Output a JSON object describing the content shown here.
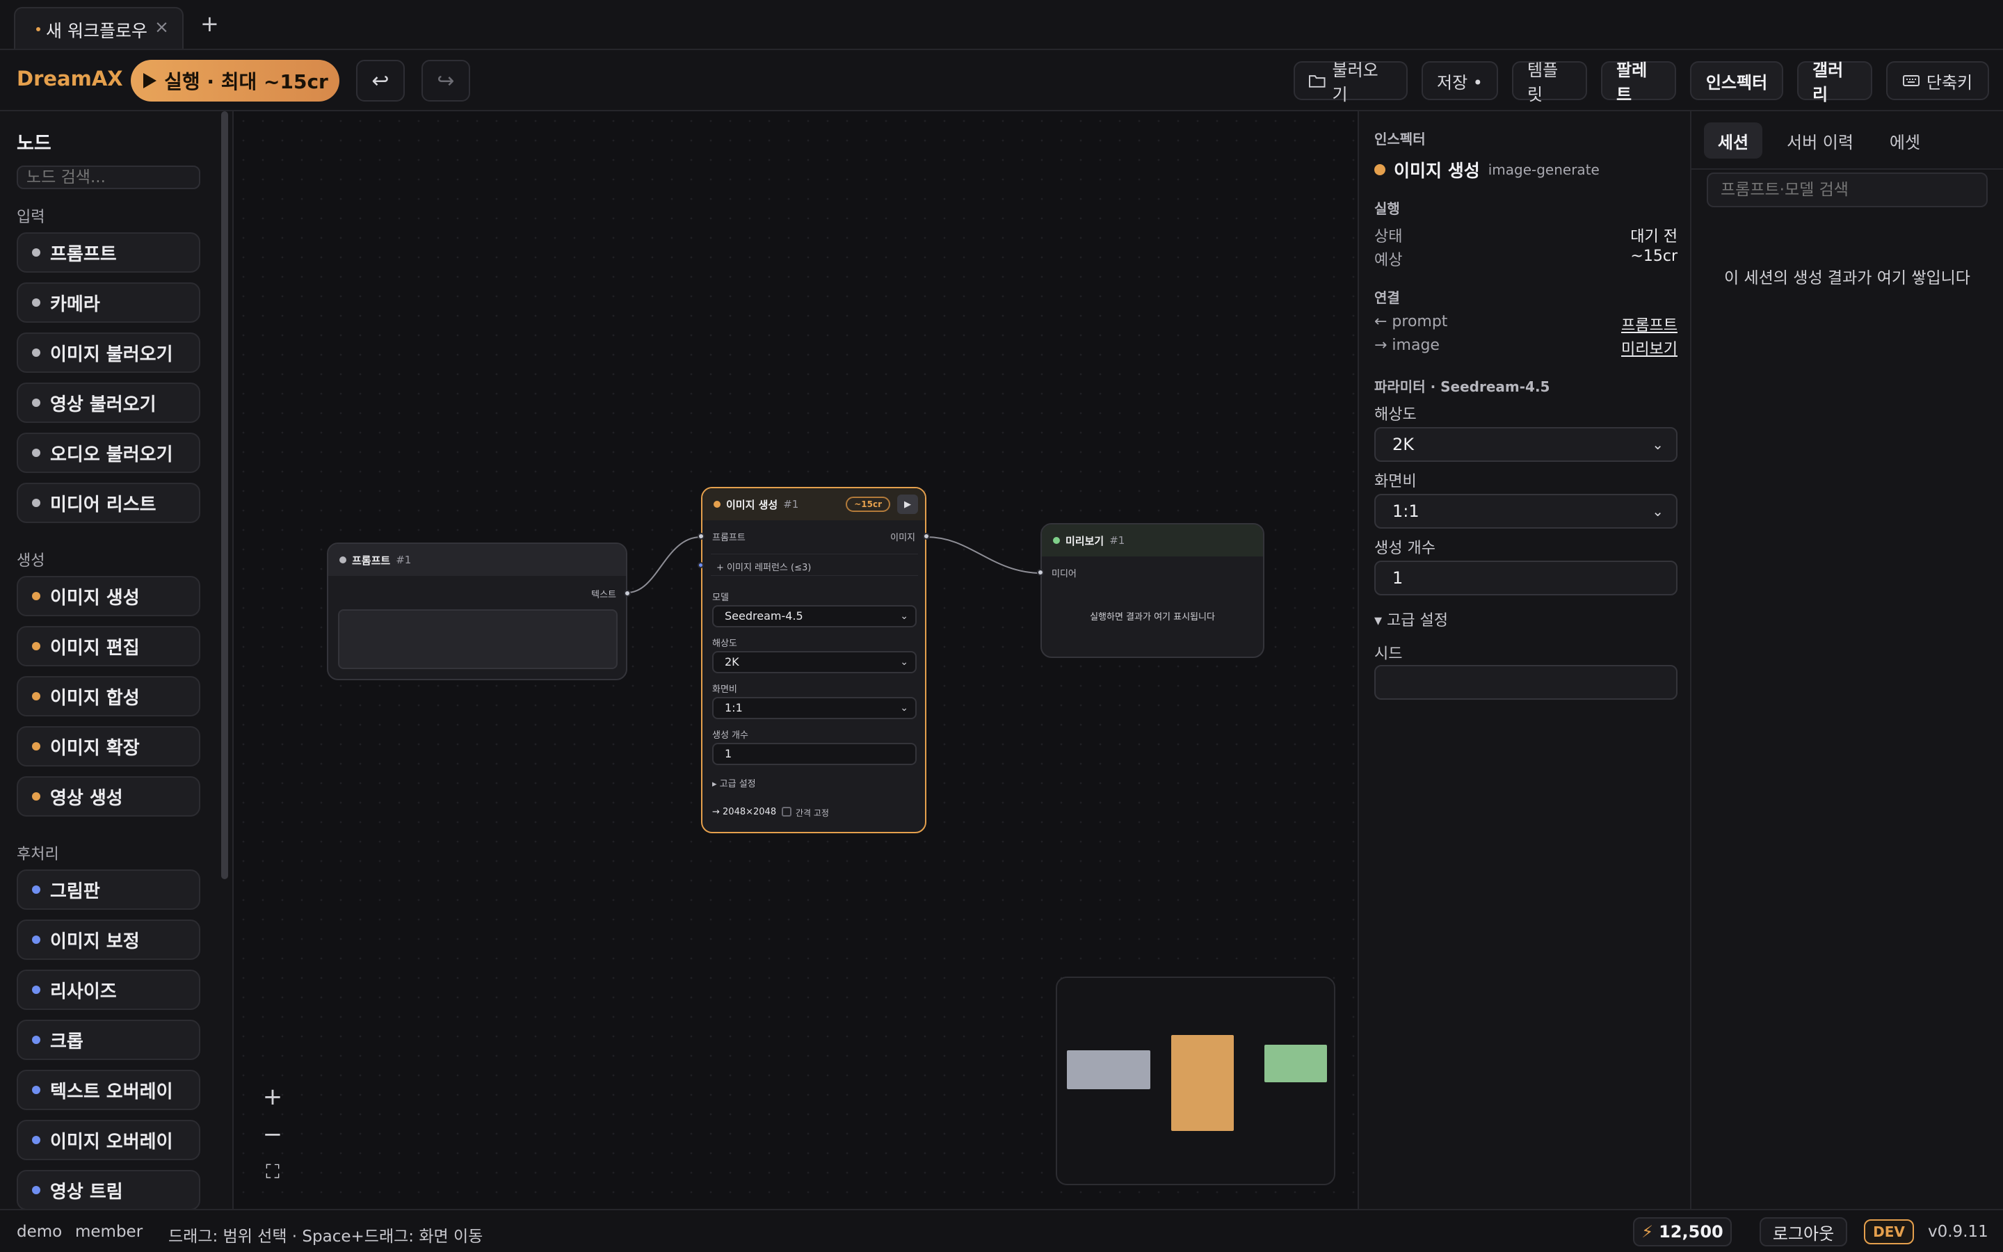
{
  "tab": {
    "title": "새 워크플로우",
    "close": "×",
    "add": "+"
  },
  "toolbar": {
    "logo": "DreamAX",
    "run": "실행 · 최대 ~15cr",
    "undo": "↩",
    "redo": "↪",
    "load": "불러오기",
    "save": "저장 •",
    "template": "템플릿",
    "palette": "팔레트",
    "inspector": "인스펙터",
    "gallery": "갤러리",
    "shortcuts": "단축키"
  },
  "sidebar": {
    "title": "노드",
    "search_placeholder": "노드 검색...",
    "sections": [
      {
        "title": "입력",
        "items": [
          "프롬프트",
          "카메라",
          "이미지 불러오기",
          "영상 불러오기",
          "오디오 불러오기",
          "미디어 리스트"
        ]
      },
      {
        "title": "생성",
        "items": [
          "이미지 생성",
          "이미지 편집",
          "이미지 합성",
          "이미지 확장",
          "영상 생성"
        ]
      },
      {
        "title": "후처리",
        "items": [
          "그림판",
          "이미지 보정",
          "리사이즈",
          "크롭",
          "텍스트 오버레이",
          "이미지 오버레이",
          "영상 트림"
        ]
      }
    ]
  },
  "colors": {
    "input": "#b7b7bd",
    "generate": "#e5a04d",
    "post": "#6f8ff2",
    "preview": "#7fd08a",
    "accent": "#e5a04d"
  },
  "nodes": {
    "prompt": {
      "title": "프롬프트",
      "num": "#1",
      "out_label": "텍스트"
    },
    "generate": {
      "title": "이미지 생성",
      "num": "#1",
      "cost": "~15cr",
      "play": "▶",
      "in_prompt": "프롬프트",
      "out_image": "이미지",
      "ref": "+ 이미지 레퍼런스 (≤3)",
      "model_label": "모델",
      "model": "Seedream-4.5",
      "res_label": "해상도",
      "res": "2K",
      "ratio_label": "화면비",
      "ratio": "1:1",
      "count_label": "생성 개수",
      "count": "1",
      "advanced": "▸ 고급 설정",
      "output": "→ 2048×2048",
      "fix": "간격 고정"
    },
    "preview": {
      "title": "미리보기",
      "num": "#1",
      "in_label": "미디어",
      "placeholder": "실행하면 결과가 여기 표시됩니다"
    }
  },
  "canvas_controls": {
    "zoom_in": "+",
    "zoom_out": "−",
    "fit": "⛶"
  },
  "inspector": {
    "caption": "인스펙터",
    "node_name": "이미지 생성",
    "node_id": "image-generate",
    "exec_caption": "실행",
    "status_label": "상태",
    "status_value": "대기 전",
    "estimate_label": "예상",
    "estimate_value": "~15cr",
    "link_caption": "연결",
    "link_in_label": "← prompt",
    "link_in_value": "프롬프트",
    "link_out_label": "→ image",
    "link_out_value": "미리보기",
    "param_caption": "파라미터 · Seedream-4.5",
    "res_label": "해상도",
    "res": "2K",
    "ratio_label": "화면비",
    "ratio": "1:1",
    "count_label": "생성 개수",
    "count": "1",
    "advanced": "▾ 고급 설정",
    "seed_label": "시드",
    "seed_value": ""
  },
  "gallery": {
    "tabs": [
      "세션",
      "서버 이력",
      "에셋"
    ],
    "search_placeholder": "프롬프트·모델 검색",
    "empty": "이 세션의 생성 결과가 여기 쌓입니다"
  },
  "status": {
    "user": "demo",
    "role": "member",
    "hint": "드래그: 범위 선택 · Space+드래그: 화면 이동",
    "credits": "12,500",
    "logout": "로그아웃",
    "env": "DEV",
    "version": "v0.9.11"
  }
}
